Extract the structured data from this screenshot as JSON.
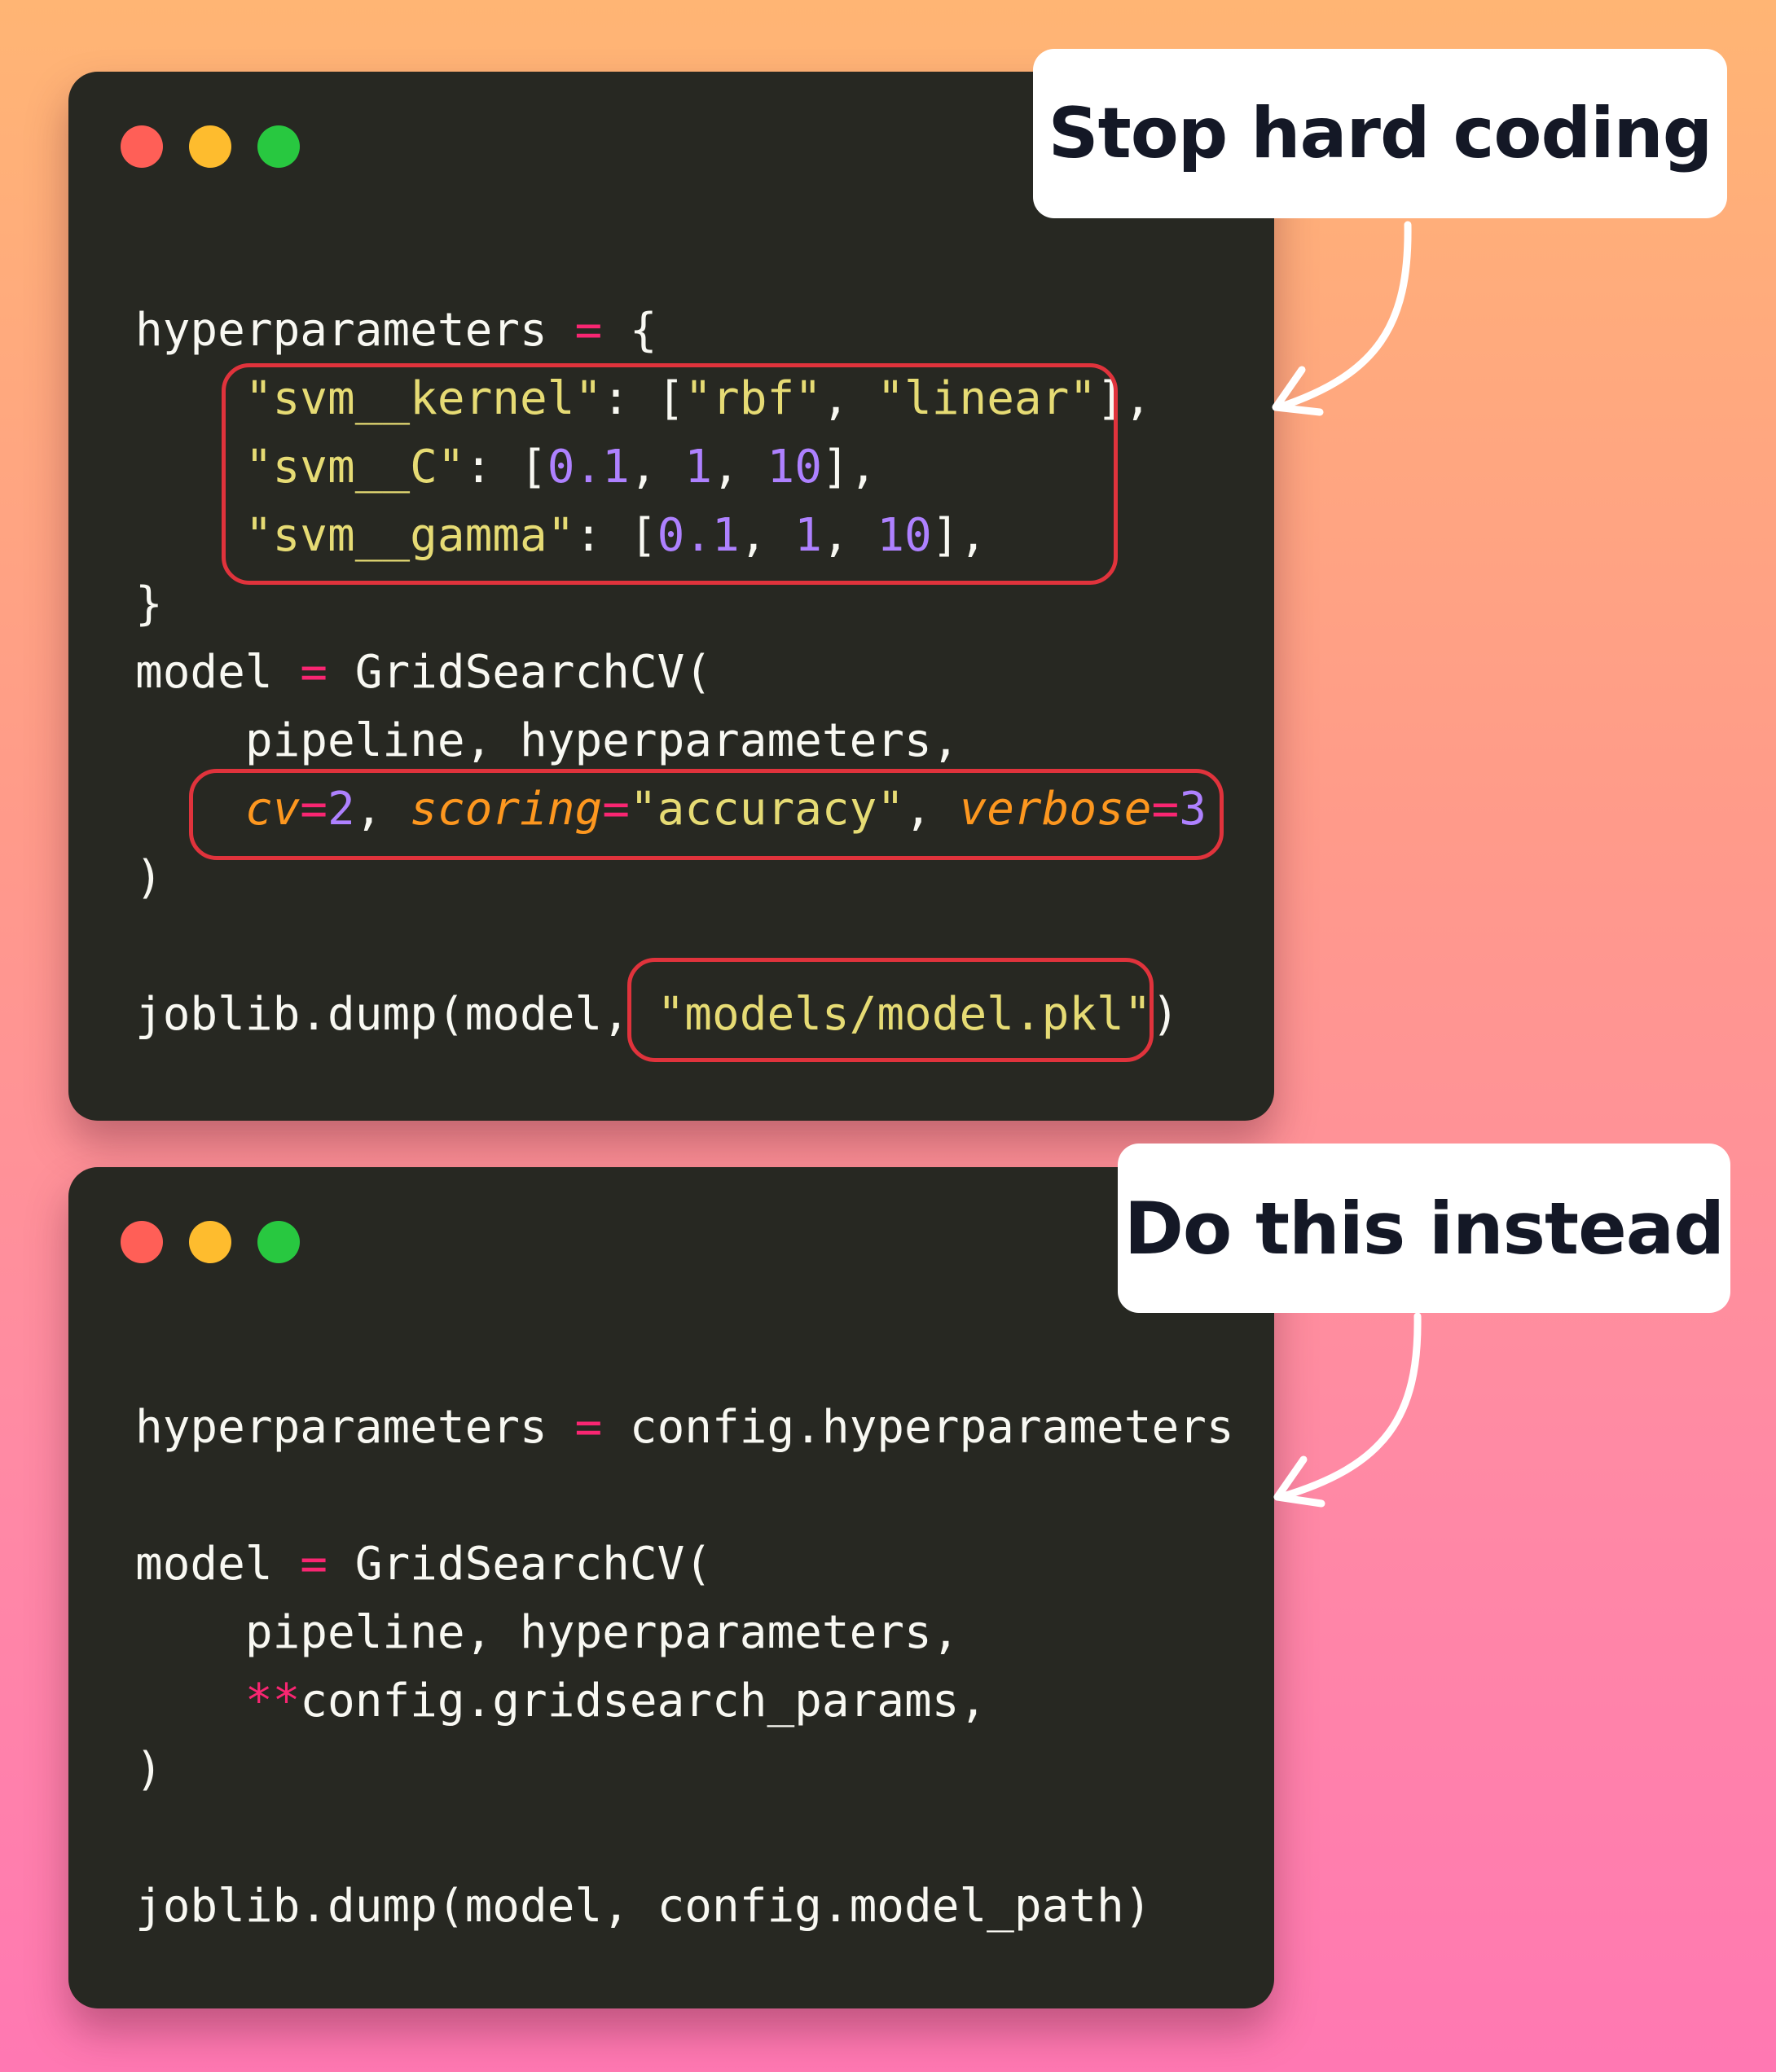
{
  "callouts": {
    "top": "Stop hard coding",
    "bottom": "Do this instead"
  },
  "colors": {
    "background_top": "#ffb574",
    "background_bottom": "#ff78b2",
    "window_bg": "#272822",
    "highlight_box": "#e0333c",
    "text_default": "#f8f8f2",
    "operator": "#f92672",
    "string": "#e6db74",
    "number": "#ae81ff",
    "keyword_arg": "#fd971f"
  },
  "window_controls": [
    "close-dot",
    "minimize-dot",
    "maximize-dot"
  ],
  "code_before": {
    "l1_a": "hyperparameters ",
    "l1_op": "=",
    "l1_b": " {",
    "l2_ind": "    ",
    "l2_s1": "\"svm__kernel\"",
    "l2_a": ": [",
    "l2_s2": "\"rbf\"",
    "l2_b": ", ",
    "l2_s3": "\"linear\"",
    "l2_c": "],",
    "l3_ind": "    ",
    "l3_s1": "\"svm__C\"",
    "l3_a": ": [",
    "l3_n1": "0.1",
    "l3_b": ", ",
    "l3_n2": "1",
    "l3_c": ", ",
    "l3_n3": "10",
    "l3_d": "],",
    "l4_ind": "    ",
    "l4_s1": "\"svm__gamma\"",
    "l4_a": ": [",
    "l4_n1": "0.1",
    "l4_b": ", ",
    "l4_n2": "1",
    "l4_c": ", ",
    "l4_n3": "10",
    "l4_d": "],",
    "l5": "}",
    "l6_a": "model ",
    "l6_op": "=",
    "l6_b": " GridSearchCV(",
    "l7": "    pipeline, hyperparameters,",
    "l8_ind": "    ",
    "l8_k1": "cv",
    "l8_op1": "=",
    "l8_n1": "2",
    "l8_a": ", ",
    "l8_k2": "scoring",
    "l8_op2": "=",
    "l8_s1": "\"accuracy\"",
    "l8_b": ", ",
    "l8_k3": "verbose",
    "l8_op3": "=",
    "l8_n2": "3",
    "l9": ")",
    "l11_a": "joblib.dump(model, ",
    "l11_s": "\"models/model.pkl\"",
    "l11_b": ")"
  },
  "code_after": {
    "l1_a": "hyperparameters ",
    "l1_op": "=",
    "l1_b": " config.hyperparameters",
    "l3_a": "model ",
    "l3_op": "=",
    "l3_b": " GridSearchCV(",
    "l4": "    pipeline, hyperparameters,",
    "l5_ind": "    ",
    "l5_op": "**",
    "l5_b": "config.gridsearch_params,",
    "l6": ")",
    "l8": "joblib.dump(model, config.model_path)"
  }
}
